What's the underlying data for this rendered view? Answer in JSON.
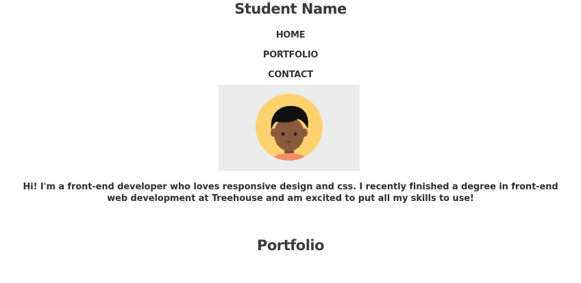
{
  "header": {
    "title": "Student Name"
  },
  "nav": {
    "items": [
      {
        "label": "HOME"
      },
      {
        "label": "PORTFOLIO"
      },
      {
        "label": "CONTACT"
      }
    ]
  },
  "hero": {
    "avatar_icon": "student-avatar-icon",
    "colors": {
      "panel": "#ececec",
      "circle": "#ffd26e",
      "hair": "#111111",
      "skin": "#8a5a3c",
      "shirt": "#f28b67"
    }
  },
  "intro": {
    "text": "Hi! I'm a front-end developer who loves responsive design and css. I recently finished a degree in front-end web development at Treehouse and am excited to put all my skills to use!"
  },
  "portfolio": {
    "heading": "Portfolio"
  }
}
